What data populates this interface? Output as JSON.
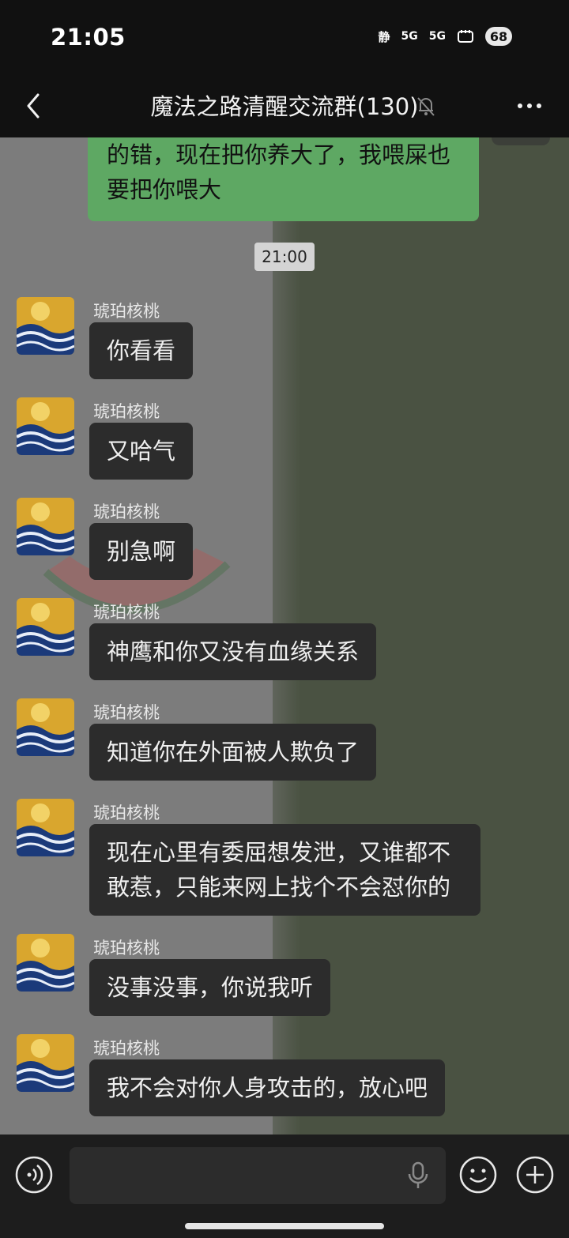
{
  "status_bar": {
    "time": "21:05",
    "silent": "静",
    "signal1": "5G",
    "signal2": "5G",
    "battery": "68"
  },
  "nav": {
    "back_icon": "chevron-left-icon",
    "title": "魔法之路清醒交流群(130)",
    "mute_icon": "bell-muted-icon",
    "more_icon": "more-dots-icon"
  },
  "chat": {
    "outgoing": {
      "text": "的错，现在把你养大了，我喂屎也要把你喂大"
    },
    "timestamp": "21:00",
    "messages": [
      {
        "sender": "琥珀核桃",
        "text": "你看看"
      },
      {
        "sender": "琥珀核桃",
        "text": "又哈气"
      },
      {
        "sender": "琥珀核桃",
        "text": "别急啊"
      },
      {
        "sender": "琥珀核桃",
        "text": "神鹰和你又没有血缘关系"
      },
      {
        "sender": "琥珀核桃",
        "text": "知道你在外面被人欺负了"
      },
      {
        "sender": "琥珀核桃",
        "text": "现在心里有委屈想发泄，又谁都不敢惹，只能来网上找个不会怼你的"
      },
      {
        "sender": "琥珀核桃",
        "text": "没事没事，你说我听"
      },
      {
        "sender": "琥珀核桃",
        "text": "我不会对你人身攻击的，放心吧"
      }
    ]
  },
  "input_bar": {
    "voice_icon": "voice-icon",
    "message_value": "",
    "mic_icon": "mic-icon",
    "emoji_icon": "emoji-icon",
    "plus_icon": "plus-icon"
  },
  "colors": {
    "outgoing_bubble": "#5ea863",
    "incoming_bubble": "#2c2c2c",
    "bar_background": "#111111"
  }
}
